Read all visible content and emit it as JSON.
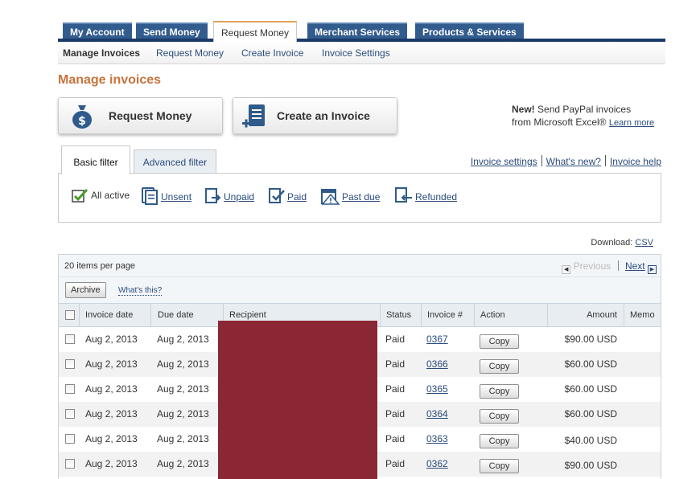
{
  "nav": {
    "tabs": [
      {
        "label": "My Account"
      },
      {
        "label": "Send Money"
      },
      {
        "label": "Request Money"
      },
      {
        "label": "Merchant Services"
      },
      {
        "label": "Products & Services"
      }
    ],
    "subtabs": [
      {
        "label": "Manage Invoices"
      },
      {
        "label": "Request Money"
      },
      {
        "label": "Create Invoice"
      },
      {
        "label": "Invoice Settings"
      }
    ]
  },
  "page_title": "Manage invoices",
  "actions": {
    "request_money": "Request Money",
    "create_invoice": "Create an Invoice"
  },
  "promo": {
    "bold": "New!",
    "text1": "Send PayPal invoices",
    "text2": "from Microsoft Excel®",
    "link": "Learn more"
  },
  "filters": {
    "basic_tab": "Basic filter",
    "advanced_tab": "Advanced filter",
    "links": [
      "Invoice settings",
      "What's new?",
      "Invoice help"
    ],
    "items": [
      {
        "label": "All active",
        "icon": "all-active-icon"
      },
      {
        "label": "Unsent",
        "icon": "unsent-icon"
      },
      {
        "label": "Unpaid",
        "icon": "unpaid-icon"
      },
      {
        "label": "Paid",
        "icon": "paid-icon"
      },
      {
        "label": "Past due",
        "icon": "past-due-icon"
      },
      {
        "label": "Refunded",
        "icon": "refunded-icon"
      }
    ]
  },
  "download": {
    "label": "Download:",
    "link": "CSV"
  },
  "table": {
    "per_page": "20 items per page",
    "prev": "Previous",
    "next": "Next",
    "archive": "Archive",
    "whats_this": "What's this?",
    "columns": [
      "Invoice date",
      "Due date",
      "Recipient",
      "Status",
      "Invoice #",
      "Action",
      "Amount",
      "Memo"
    ],
    "rows": [
      {
        "invoice_date": "Aug 2, 2013",
        "due_date": "Aug 2, 2013",
        "status": "Paid",
        "invoice": "0367",
        "action": "Copy",
        "amount": "$90.00 USD"
      },
      {
        "invoice_date": "Aug 2, 2013",
        "due_date": "Aug 2, 2013",
        "status": "Paid",
        "invoice": "0366",
        "action": "Copy",
        "amount": "$60.00 USD"
      },
      {
        "invoice_date": "Aug 2, 2013",
        "due_date": "Aug 2, 2013",
        "status": "Paid",
        "invoice": "0365",
        "action": "Copy",
        "amount": "$60.00 USD"
      },
      {
        "invoice_date": "Aug 2, 2013",
        "due_date": "Aug 2, 2013",
        "status": "Paid",
        "invoice": "0364",
        "action": "Copy",
        "amount": "$60.00 USD"
      },
      {
        "invoice_date": "Aug 2, 2013",
        "due_date": "Aug 2, 2013",
        "status": "Paid",
        "invoice": "0363",
        "action": "Copy",
        "amount": "$40.00 USD"
      },
      {
        "invoice_date": "Aug 2, 2013",
        "due_date": "Aug 2, 2013",
        "status": "Paid",
        "invoice": "0362",
        "action": "Copy",
        "amount": "$90.00 USD"
      }
    ]
  },
  "colors": {
    "brand_navy": "#1a3a6b",
    "tab_blue": "#325c8e",
    "title_orange": "#c8733b",
    "link_blue": "#2a4b7c",
    "redaction": "#8b2735"
  }
}
